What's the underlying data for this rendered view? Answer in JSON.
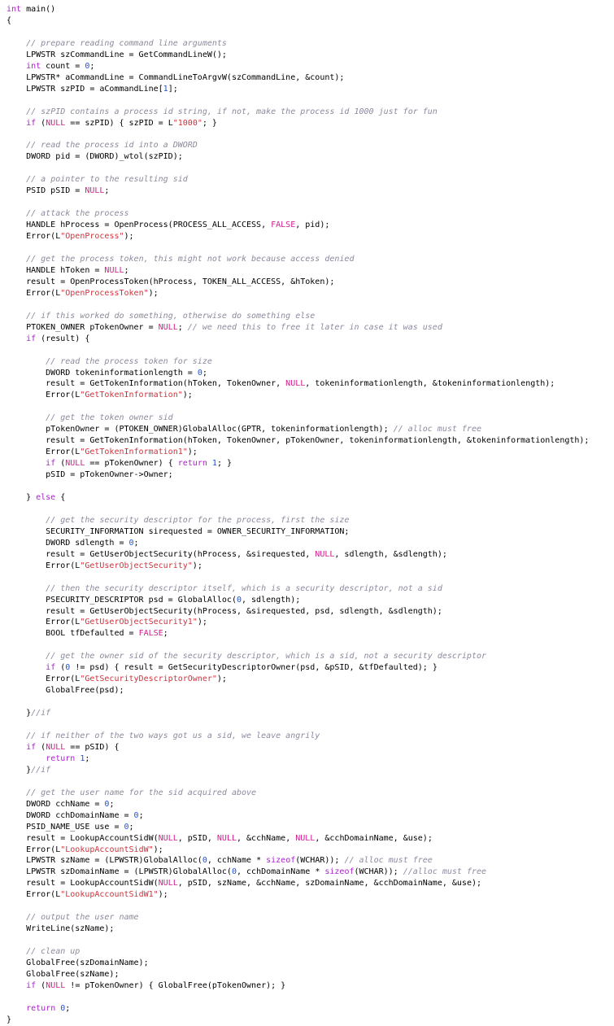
{
  "document": {
    "language": "C++",
    "kind": "source-code-listing",
    "colors": {
      "background": "#ffffff",
      "plain": "#000000",
      "keyword": "#aa22cc",
      "comment": "#8a8a9e",
      "string": "#d4303b",
      "number": "#1f4fd8",
      "constant": "#d02090"
    }
  },
  "code": {
    "lines": [
      [
        {
          "t": "int",
          "c": "kw"
        },
        {
          "t": " main()",
          "c": "pl"
        }
      ],
      [
        {
          "t": "{",
          "c": "pl"
        }
      ],
      [],
      [
        {
          "t": "    ",
          "c": "pl"
        },
        {
          "t": "// prepare reading command line arguments",
          "c": "cm"
        }
      ],
      [
        {
          "t": "    LPWSTR szCommandLine = GetCommandLineW();",
          "c": "pl"
        }
      ],
      [
        {
          "t": "    ",
          "c": "pl"
        },
        {
          "t": "int",
          "c": "kw"
        },
        {
          "t": " count = ",
          "c": "pl"
        },
        {
          "t": "0",
          "c": "nu"
        },
        {
          "t": ";",
          "c": "pl"
        }
      ],
      [
        {
          "t": "    LPWSTR* aCommandLine = CommandLineToArgvW(szCommandLine, &count);",
          "c": "pl"
        }
      ],
      [
        {
          "t": "    LPWSTR szPID = aCommandLine[",
          "c": "pl"
        },
        {
          "t": "1",
          "c": "nu"
        },
        {
          "t": "];",
          "c": "pl"
        }
      ],
      [],
      [
        {
          "t": "    ",
          "c": "pl"
        },
        {
          "t": "// szPID contains a process id string, if not, make the process id 1000 just for fun",
          "c": "cm"
        }
      ],
      [
        {
          "t": "    ",
          "c": "pl"
        },
        {
          "t": "if",
          "c": "kw"
        },
        {
          "t": " (",
          "c": "pl"
        },
        {
          "t": "NULL",
          "c": "cn"
        },
        {
          "t": " == szPID) { szPID = L",
          "c": "pl"
        },
        {
          "t": "\"1000\"",
          "c": "st"
        },
        {
          "t": "; }",
          "c": "pl"
        }
      ],
      [],
      [
        {
          "t": "    ",
          "c": "pl"
        },
        {
          "t": "// read the process id into a DWORD",
          "c": "cm"
        }
      ],
      [
        {
          "t": "    DWORD pid = (DWORD)_wtol(szPID);",
          "c": "pl"
        }
      ],
      [],
      [
        {
          "t": "    ",
          "c": "pl"
        },
        {
          "t": "// a pointer to the resulting sid",
          "c": "cm"
        }
      ],
      [
        {
          "t": "    PSID pSID = ",
          "c": "pl"
        },
        {
          "t": "NULL",
          "c": "cn"
        },
        {
          "t": ";",
          "c": "pl"
        }
      ],
      [],
      [
        {
          "t": "    ",
          "c": "pl"
        },
        {
          "t": "// attack the process",
          "c": "cm"
        }
      ],
      [
        {
          "t": "    HANDLE hProcess = OpenProcess(PROCESS_ALL_ACCESS, ",
          "c": "pl"
        },
        {
          "t": "FALSE",
          "c": "cn"
        },
        {
          "t": ", pid);",
          "c": "pl"
        }
      ],
      [
        {
          "t": "    Error(L",
          "c": "pl"
        },
        {
          "t": "\"OpenProcess\"",
          "c": "st"
        },
        {
          "t": ");",
          "c": "pl"
        }
      ],
      [],
      [
        {
          "t": "    ",
          "c": "pl"
        },
        {
          "t": "// get the process token, this might not work because access denied",
          "c": "cm"
        }
      ],
      [
        {
          "t": "    HANDLE hToken = ",
          "c": "pl"
        },
        {
          "t": "NULL",
          "c": "cn"
        },
        {
          "t": ";",
          "c": "pl"
        }
      ],
      [
        {
          "t": "    result = OpenProcessToken(hProcess, TOKEN_ALL_ACCESS, &hToken);",
          "c": "pl"
        }
      ],
      [
        {
          "t": "    Error(L",
          "c": "pl"
        },
        {
          "t": "\"OpenProcessToken\"",
          "c": "st"
        },
        {
          "t": ");",
          "c": "pl"
        }
      ],
      [],
      [
        {
          "t": "    ",
          "c": "pl"
        },
        {
          "t": "// if this worked do something, otherwise do something else",
          "c": "cm"
        }
      ],
      [
        {
          "t": "    PTOKEN_OWNER pTokenOwner = ",
          "c": "pl"
        },
        {
          "t": "NULL",
          "c": "cn"
        },
        {
          "t": "; ",
          "c": "pl"
        },
        {
          "t": "// we need this to free it later in case it was used",
          "c": "cm"
        }
      ],
      [
        {
          "t": "    ",
          "c": "pl"
        },
        {
          "t": "if",
          "c": "kw"
        },
        {
          "t": " (result) {",
          "c": "pl"
        }
      ],
      [],
      [
        {
          "t": "        ",
          "c": "pl"
        },
        {
          "t": "// read the process token for size",
          "c": "cm"
        }
      ],
      [
        {
          "t": "        DWORD tokeninformationlength = ",
          "c": "pl"
        },
        {
          "t": "0",
          "c": "nu"
        },
        {
          "t": ";",
          "c": "pl"
        }
      ],
      [
        {
          "t": "        result = GetTokenInformation(hToken, TokenOwner, ",
          "c": "pl"
        },
        {
          "t": "NULL",
          "c": "cn"
        },
        {
          "t": ", tokeninformationlength, &tokeninformationlength);",
          "c": "pl"
        }
      ],
      [
        {
          "t": "        Error(L",
          "c": "pl"
        },
        {
          "t": "\"GetTokenInformation\"",
          "c": "st"
        },
        {
          "t": ");",
          "c": "pl"
        }
      ],
      [],
      [
        {
          "t": "        ",
          "c": "pl"
        },
        {
          "t": "// get the token owner sid",
          "c": "cm"
        }
      ],
      [
        {
          "t": "        pTokenOwner = (PTOKEN_OWNER)GlobalAlloc(GPTR, tokeninformationlength); ",
          "c": "pl"
        },
        {
          "t": "// alloc must free",
          "c": "cm"
        }
      ],
      [
        {
          "t": "        result = GetTokenInformation(hToken, TokenOwner, pTokenOwner, tokeninformationlength, &tokeninformationlength);",
          "c": "pl"
        }
      ],
      [
        {
          "t": "        Error(L",
          "c": "pl"
        },
        {
          "t": "\"GetTokenInformation1\"",
          "c": "st"
        },
        {
          "t": ");",
          "c": "pl"
        }
      ],
      [
        {
          "t": "        ",
          "c": "pl"
        },
        {
          "t": "if",
          "c": "kw"
        },
        {
          "t": " (",
          "c": "pl"
        },
        {
          "t": "NULL",
          "c": "cn"
        },
        {
          "t": " == pTokenOwner) { ",
          "c": "pl"
        },
        {
          "t": "return",
          "c": "kw"
        },
        {
          "t": " ",
          "c": "pl"
        },
        {
          "t": "1",
          "c": "nu"
        },
        {
          "t": "; }",
          "c": "pl"
        }
      ],
      [
        {
          "t": "        pSID = pTokenOwner->Owner;",
          "c": "pl"
        }
      ],
      [],
      [
        {
          "t": "    } ",
          "c": "pl"
        },
        {
          "t": "else",
          "c": "kw"
        },
        {
          "t": " {",
          "c": "pl"
        }
      ],
      [],
      [
        {
          "t": "        ",
          "c": "pl"
        },
        {
          "t": "// get the security descriptor for the process, first the size",
          "c": "cm"
        }
      ],
      [
        {
          "t": "        SECURITY_INFORMATION sirequested = OWNER_SECURITY_INFORMATION;",
          "c": "pl"
        }
      ],
      [
        {
          "t": "        DWORD sdlength = ",
          "c": "pl"
        },
        {
          "t": "0",
          "c": "nu"
        },
        {
          "t": ";",
          "c": "pl"
        }
      ],
      [
        {
          "t": "        result = GetUserObjectSecurity(hProcess, &sirequested, ",
          "c": "pl"
        },
        {
          "t": "NULL",
          "c": "cn"
        },
        {
          "t": ", sdlength, &sdlength);",
          "c": "pl"
        }
      ],
      [
        {
          "t": "        Error(L",
          "c": "pl"
        },
        {
          "t": "\"GetUserObjectSecurity\"",
          "c": "st"
        },
        {
          "t": ");",
          "c": "pl"
        }
      ],
      [],
      [
        {
          "t": "        ",
          "c": "pl"
        },
        {
          "t": "// then the security descriptor itself, which is a security descriptor, not a sid",
          "c": "cm"
        }
      ],
      [
        {
          "t": "        PSECURITY_DESCRIPTOR psd = GlobalAlloc(",
          "c": "pl"
        },
        {
          "t": "0",
          "c": "nu"
        },
        {
          "t": ", sdlength);",
          "c": "pl"
        }
      ],
      [
        {
          "t": "        result = GetUserObjectSecurity(hProcess, &sirequested, psd, sdlength, &sdlength);",
          "c": "pl"
        }
      ],
      [
        {
          "t": "        Error(L",
          "c": "pl"
        },
        {
          "t": "\"GetUserObjectSecurity1\"",
          "c": "st"
        },
        {
          "t": ");",
          "c": "pl"
        }
      ],
      [
        {
          "t": "        BOOL tfDefaulted = ",
          "c": "pl"
        },
        {
          "t": "FALSE",
          "c": "cn"
        },
        {
          "t": ";",
          "c": "pl"
        }
      ],
      [],
      [
        {
          "t": "        ",
          "c": "pl"
        },
        {
          "t": "// get the owner sid of the security descriptor, which is a sid, not a security descriptor",
          "c": "cm"
        }
      ],
      [
        {
          "t": "        ",
          "c": "pl"
        },
        {
          "t": "if",
          "c": "kw"
        },
        {
          "t": " (",
          "c": "pl"
        },
        {
          "t": "0",
          "c": "nu"
        },
        {
          "t": " != psd) { result = GetSecurityDescriptorOwner(psd, &pSID, &tfDefaulted); }",
          "c": "pl"
        }
      ],
      [
        {
          "t": "        Error(L",
          "c": "pl"
        },
        {
          "t": "\"GetSecurityDescriptorOwner\"",
          "c": "st"
        },
        {
          "t": ");",
          "c": "pl"
        }
      ],
      [
        {
          "t": "        GlobalFree(psd);",
          "c": "pl"
        }
      ],
      [],
      [
        {
          "t": "    }",
          "c": "pl"
        },
        {
          "t": "//if",
          "c": "cm"
        }
      ],
      [],
      [
        {
          "t": "    ",
          "c": "pl"
        },
        {
          "t": "// if neither of the two ways got us a sid, we leave angrily",
          "c": "cm"
        }
      ],
      [
        {
          "t": "    ",
          "c": "pl"
        },
        {
          "t": "if",
          "c": "kw"
        },
        {
          "t": " (",
          "c": "pl"
        },
        {
          "t": "NULL",
          "c": "cn"
        },
        {
          "t": " == pSID) {",
          "c": "pl"
        }
      ],
      [
        {
          "t": "        ",
          "c": "pl"
        },
        {
          "t": "return",
          "c": "kw"
        },
        {
          "t": " ",
          "c": "pl"
        },
        {
          "t": "1",
          "c": "nu"
        },
        {
          "t": ";",
          "c": "pl"
        }
      ],
      [
        {
          "t": "    }",
          "c": "pl"
        },
        {
          "t": "//if",
          "c": "cm"
        }
      ],
      [],
      [
        {
          "t": "    ",
          "c": "pl"
        },
        {
          "t": "// get the user name for the sid acquired above",
          "c": "cm"
        }
      ],
      [
        {
          "t": "    DWORD cchName = ",
          "c": "pl"
        },
        {
          "t": "0",
          "c": "nu"
        },
        {
          "t": ";",
          "c": "pl"
        }
      ],
      [
        {
          "t": "    DWORD cchDomainName = ",
          "c": "pl"
        },
        {
          "t": "0",
          "c": "nu"
        },
        {
          "t": ";",
          "c": "pl"
        }
      ],
      [
        {
          "t": "    PSID_NAME_USE use = ",
          "c": "pl"
        },
        {
          "t": "0",
          "c": "nu"
        },
        {
          "t": ";",
          "c": "pl"
        }
      ],
      [
        {
          "t": "    result = LookupAccountSidW(",
          "c": "pl"
        },
        {
          "t": "NULL",
          "c": "cn"
        },
        {
          "t": ", pSID, ",
          "c": "pl"
        },
        {
          "t": "NULL",
          "c": "cn"
        },
        {
          "t": ", &cchName, ",
          "c": "pl"
        },
        {
          "t": "NULL",
          "c": "cn"
        },
        {
          "t": ", &cchDomainName, &use);",
          "c": "pl"
        }
      ],
      [
        {
          "t": "    Error(L",
          "c": "pl"
        },
        {
          "t": "\"LookupAccountSidW\"",
          "c": "st"
        },
        {
          "t": ");",
          "c": "pl"
        }
      ],
      [
        {
          "t": "    LPWSTR szName = (LPWSTR)GlobalAlloc(",
          "c": "pl"
        },
        {
          "t": "0",
          "c": "nu"
        },
        {
          "t": ", cchName * ",
          "c": "pl"
        },
        {
          "t": "sizeof",
          "c": "kw"
        },
        {
          "t": "(WCHAR)); ",
          "c": "pl"
        },
        {
          "t": "// alloc must free",
          "c": "cm"
        }
      ],
      [
        {
          "t": "    LPWSTR szDomainName = (LPWSTR)GlobalAlloc(",
          "c": "pl"
        },
        {
          "t": "0",
          "c": "nu"
        },
        {
          "t": ", cchDomainName * ",
          "c": "pl"
        },
        {
          "t": "sizeof",
          "c": "kw"
        },
        {
          "t": "(WCHAR)); ",
          "c": "pl"
        },
        {
          "t": "//alloc must free",
          "c": "cm"
        }
      ],
      [
        {
          "t": "    result = LookupAccountSidW(",
          "c": "pl"
        },
        {
          "t": "NULL",
          "c": "cn"
        },
        {
          "t": ", pSID, szName, &cchName, szDomainName, &cchDomainName, &use);",
          "c": "pl"
        }
      ],
      [
        {
          "t": "    Error(L",
          "c": "pl"
        },
        {
          "t": "\"LookupAccountSidW1\"",
          "c": "st"
        },
        {
          "t": ");",
          "c": "pl"
        }
      ],
      [],
      [
        {
          "t": "    ",
          "c": "pl"
        },
        {
          "t": "// output the user name",
          "c": "cm"
        }
      ],
      [
        {
          "t": "    WriteLine(szName);",
          "c": "pl"
        }
      ],
      [],
      [
        {
          "t": "    ",
          "c": "pl"
        },
        {
          "t": "// clean up",
          "c": "cm"
        }
      ],
      [
        {
          "t": "    GlobalFree(szDomainName);",
          "c": "pl"
        }
      ],
      [
        {
          "t": "    GlobalFree(szName);",
          "c": "pl"
        }
      ],
      [
        {
          "t": "    ",
          "c": "pl"
        },
        {
          "t": "if",
          "c": "kw"
        },
        {
          "t": " (",
          "c": "pl"
        },
        {
          "t": "NULL",
          "c": "cn"
        },
        {
          "t": " != pTokenOwner) { GlobalFree(pTokenOwner); }",
          "c": "pl"
        }
      ],
      [],
      [
        {
          "t": "    ",
          "c": "pl"
        },
        {
          "t": "return",
          "c": "kw"
        },
        {
          "t": " ",
          "c": "pl"
        },
        {
          "t": "0",
          "c": "nu"
        },
        {
          "t": ";",
          "c": "pl"
        }
      ],
      [
        {
          "t": "}",
          "c": "pl"
        }
      ]
    ]
  }
}
